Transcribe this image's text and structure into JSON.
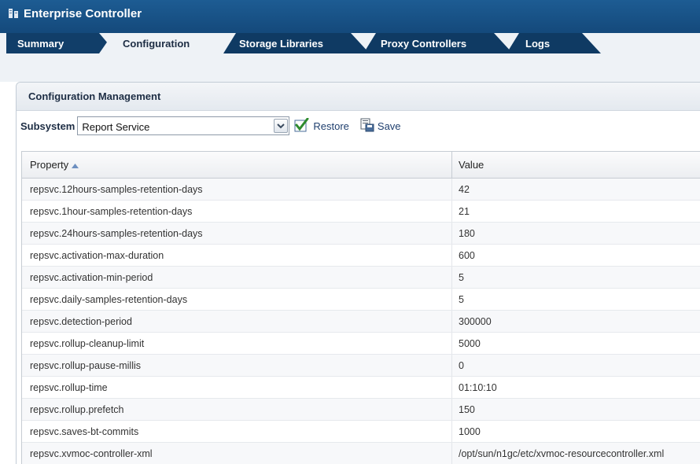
{
  "app": {
    "title": "Enterprise Controller"
  },
  "tabs": [
    {
      "label": "Summary",
      "active": false
    },
    {
      "label": "Configuration",
      "active": true
    },
    {
      "label": "Storage Libraries",
      "active": false
    },
    {
      "label": "Proxy Controllers",
      "active": false
    },
    {
      "label": "Logs",
      "active": false
    }
  ],
  "panel": {
    "title": "Configuration Management"
  },
  "toolbar": {
    "subsystem_label": "Subsystem",
    "subsystem_value": "Report Service",
    "restore_label": "Restore",
    "save_label": "Save"
  },
  "table": {
    "columns": [
      "Property",
      "Value"
    ],
    "sort": {
      "column": "Property",
      "direction": "ascending"
    },
    "rows": [
      [
        "repsvc.12hours-samples-retention-days",
        "42"
      ],
      [
        "repsvc.1hour-samples-retention-days",
        "21"
      ],
      [
        "repsvc.24hours-samples-retention-days",
        "180"
      ],
      [
        "repsvc.activation-max-duration",
        "600"
      ],
      [
        "repsvc.activation-min-period",
        "5"
      ],
      [
        "repsvc.daily-samples-retention-days",
        "5"
      ],
      [
        "repsvc.detection-period",
        "300000"
      ],
      [
        "repsvc.rollup-cleanup-limit",
        "5000"
      ],
      [
        "repsvc.rollup-pause-millis",
        "0"
      ],
      [
        "repsvc.rollup-time",
        "01:10:10"
      ],
      [
        "repsvc.rollup.prefetch",
        "150"
      ],
      [
        "repsvc.saves-bt-commits",
        "1000"
      ],
      [
        "repsvc.xvmoc-controller-xml",
        "/opt/sun/n1gc/etc/xvmoc-resourcecontroller.xml"
      ]
    ]
  },
  "colors": {
    "header": "#1d5c93",
    "accent": "#1f3f6e",
    "restore_check": "#2e8b2e"
  }
}
